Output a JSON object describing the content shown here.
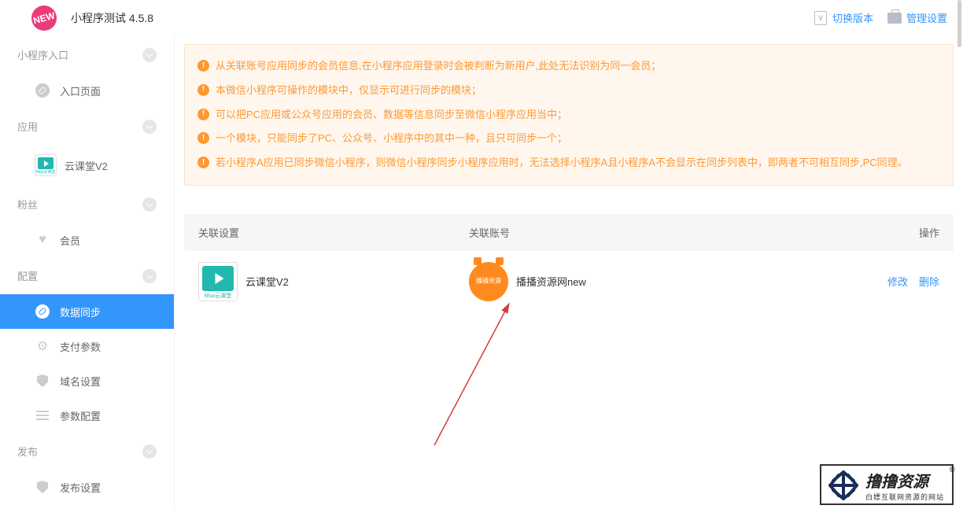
{
  "header": {
    "title": "小程序测试 4.5.8",
    "logo_text": "NEW",
    "actions": {
      "switch_version": "切换版本",
      "manage_settings": "管理设置"
    }
  },
  "sidebar": {
    "groups": [
      {
        "label": "小程序入口",
        "items": [
          {
            "id": "entry-page",
            "label": "入口页面",
            "icon": "link"
          }
        ]
      },
      {
        "label": "应用",
        "items": [
          {
            "id": "yunketang",
            "label": "云课堂V2",
            "icon": "app-yun",
            "app_caption": "Muu云课堂"
          }
        ]
      },
      {
        "label": "粉丝",
        "items": [
          {
            "id": "members",
            "label": "会员",
            "icon": "heart"
          }
        ]
      },
      {
        "label": "配置",
        "items": [
          {
            "id": "data-sync",
            "label": "数据同步",
            "icon": "link",
            "active": true
          },
          {
            "id": "pay-params",
            "label": "支付参数",
            "icon": "gear"
          },
          {
            "id": "domain",
            "label": "域名设置",
            "icon": "shield"
          },
          {
            "id": "param-config",
            "label": "参数配置",
            "icon": "list"
          }
        ]
      },
      {
        "label": "发布",
        "items": [
          {
            "id": "publish",
            "label": "发布设置",
            "icon": "shield"
          }
        ]
      }
    ]
  },
  "notice": {
    "items": [
      "从关联账号应用同步的会员信息,在小程序应用登录时会被判断为新用户,此处无法识别为同一会员；",
      "本微信小程序可操作的模块中，仅显示可进行同步的模块；",
      "可以把PC应用或公众号应用的会员、数据等信息同步至微信小程序应用当中；",
      "一个模块，只能同步了PC、公众号、小程序中的其中一种，且只可同步一个；",
      "若小程序A应用已同步微信小程序，则微信小程序同步小程序应用时，无法选择小程序A且小程序A不会显示在同步列表中，即两者不可相互同步,PC同理。"
    ]
  },
  "table": {
    "headers": {
      "settings": "关联设置",
      "account": "关联账号",
      "ops": "操作"
    },
    "rows": [
      {
        "settings_label": "云课堂V2",
        "settings_caption": "Muu云课堂",
        "account_label": "播播资源网new",
        "account_icon_text": "播播资源",
        "edit": "修改",
        "delete": "删除"
      }
    ]
  },
  "watermark": {
    "title": "撸撸资源",
    "subtitle": "白嫖互联网资源的网站",
    "reg": "®"
  }
}
